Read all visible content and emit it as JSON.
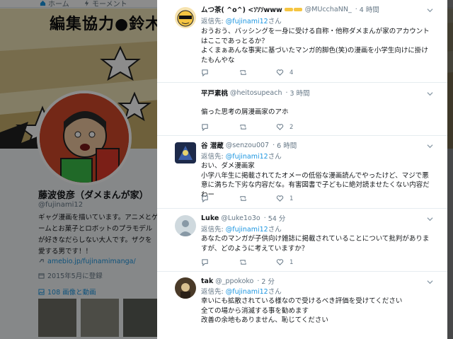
{
  "background": {
    "nav": {
      "home": "ホーム",
      "moments": "モーメント"
    },
    "banner_text": "編集協力●鈴木",
    "profile": {
      "name": "藤波俊彦（ダメまんが家）",
      "handle": "@fujinami12",
      "bio": "ギャグ漫画を描いています。アニメとゲームとお菓子とロボットのプラモデルが好きなだらしない大人です。ザクを愛する男です！！",
      "link": "amebio.jp/fujinamimanga/",
      "joined": "2015年5月に登録",
      "media": "108 画像と動画"
    }
  },
  "tweets": [
    {
      "name": "ムつ茶( ^o^) <ｿｿｿwww",
      "handle": "@MUcchaNN_",
      "time": "4 時間",
      "reply_label": "返信先:",
      "reply_to": "@fujinami12",
      "reply_suffix": "さん",
      "text": "おうおう、バッシングを一身に受ける自称・他称ダメまんが家のアカウントはここであっとるか？\nよくまぁあんな事実に基づいたマンガ的脚色(笑)の漫画を小学生向けに掛けたもんやな",
      "replies": "",
      "retweets": "",
      "likes": "4"
    },
    {
      "name": "平戸素桃",
      "handle": "@heitosupeach",
      "time": "3 時間",
      "reply_label": "",
      "reply_to": "",
      "reply_suffix": "",
      "text": "偏った思考の屑漫画家のアホ",
      "replies": "",
      "retweets": "",
      "likes": "2"
    },
    {
      "name": "谷 潜蔵",
      "handle": "@senzou007",
      "time": "6 時間",
      "reply_label": "返信先:",
      "reply_to": "@fujinami12",
      "reply_suffix": "さん",
      "text": "おい、ダメ漫画家\n小学八年生に掲載されてたオメーの低俗な漫画読んでやったけど、マジで悪意に満ちた下劣な内容だな。有害図書で子どもに絶対読ませたくない内容だわー",
      "replies": "",
      "retweets": "",
      "likes": "1"
    },
    {
      "name": "Luke",
      "handle": "@Luke1o3o",
      "time": "54 分",
      "reply_label": "返信先:",
      "reply_to": "@fujinami12",
      "reply_suffix": "さん",
      "text": "あなたのマンガが子供向け雑誌に掲載されていることについて批判がありますが、どのように考えていますか？",
      "replies": "",
      "retweets": "",
      "likes": "1"
    },
    {
      "name": "tak",
      "handle": "@_ppokoko",
      "time": "2 分",
      "reply_label": "返信先:",
      "reply_to": "@fujinami12",
      "reply_suffix": "さん",
      "text": "幸いにも拡散されている様なので受けるべき評価を受けてください\n全ての場から消滅する事を勧めます\n改善の余地もありません、恥じてください",
      "replies": "",
      "retweets": "",
      "likes": ""
    }
  ],
  "colors": {
    "accent": "#1b95e0",
    "muted": "#657786",
    "text": "#14171a"
  }
}
